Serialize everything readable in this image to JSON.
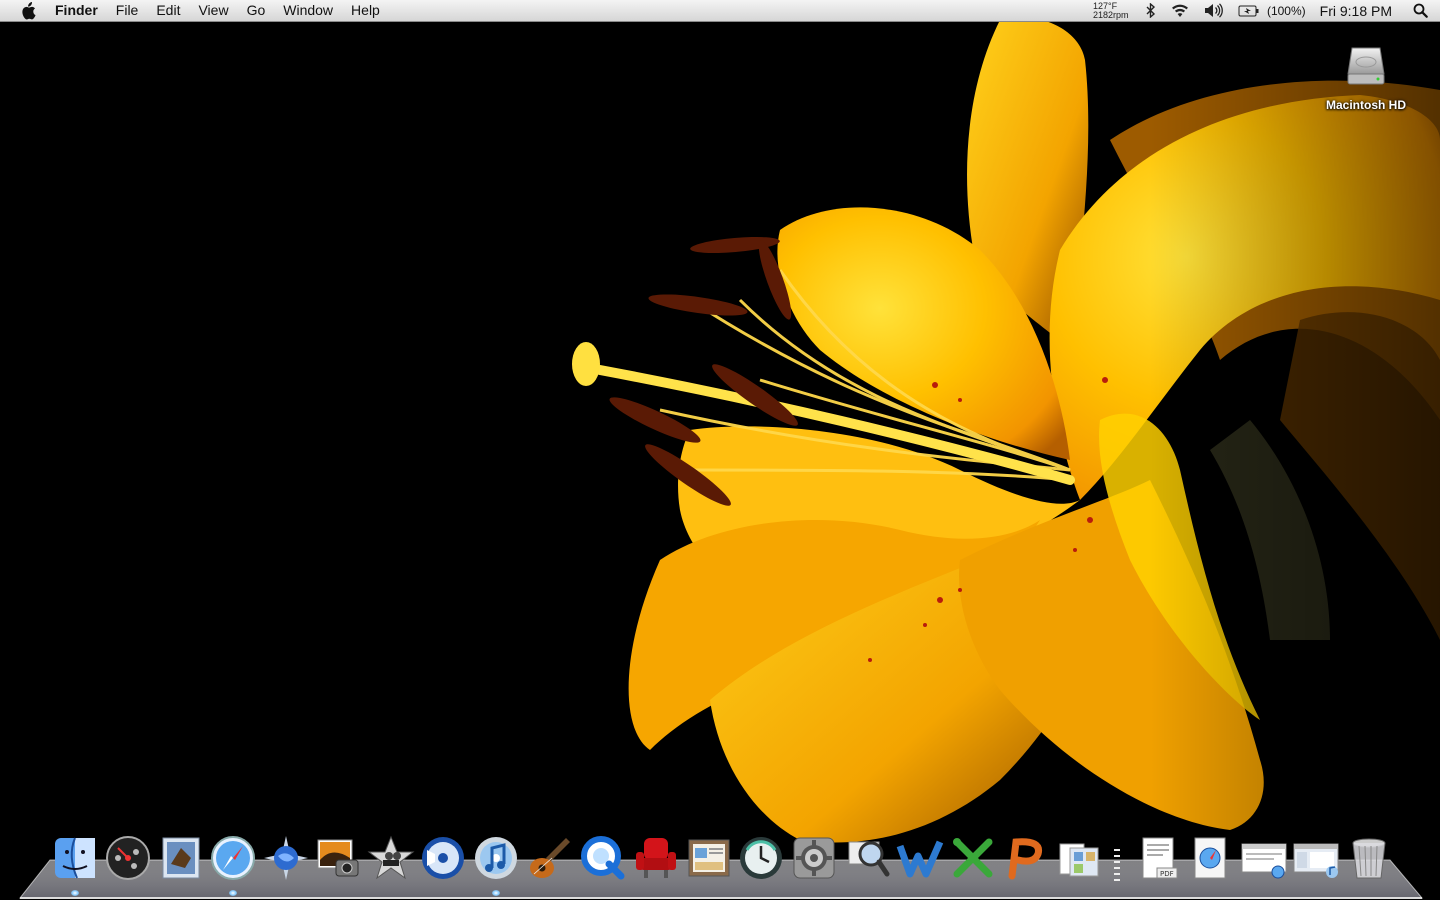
{
  "menubar": {
    "app_name": "Finder",
    "menus": [
      "File",
      "Edit",
      "View",
      "Go",
      "Window",
      "Help"
    ],
    "status": {
      "temperature": "127°F",
      "fan_speed": "2182rpm",
      "battery_percent": "(100%)",
      "clock": "Fri 9:18 PM"
    },
    "icons": [
      "apple-icon",
      "bluetooth-icon",
      "wifi-icon",
      "volume-icon",
      "battery-icon",
      "spotlight-icon"
    ]
  },
  "desktop": {
    "icons": [
      {
        "label": "Macintosh HD",
        "icon": "hard-drive-icon"
      }
    ]
  },
  "dock": {
    "apps": [
      {
        "name": "Finder",
        "icon": "finder-icon",
        "running": true
      },
      {
        "name": "Dashboard",
        "icon": "dashboard-icon",
        "running": false
      },
      {
        "name": "Mail",
        "icon": "mail-icon",
        "running": false
      },
      {
        "name": "Safari",
        "icon": "safari-icon",
        "running": true
      },
      {
        "name": "Camino",
        "icon": "camino-icon",
        "running": false
      },
      {
        "name": "iPhoto",
        "icon": "iphoto-icon",
        "running": false
      },
      {
        "name": "iMovie",
        "icon": "imovie-icon",
        "running": false
      },
      {
        "name": "iDVD",
        "icon": "idvd-icon",
        "running": false
      },
      {
        "name": "iTunes",
        "icon": "itunes-icon",
        "running": true
      },
      {
        "name": "GarageBand",
        "icon": "garageband-icon",
        "running": false
      },
      {
        "name": "QuickTime Player",
        "icon": "quicktime-icon",
        "running": false
      },
      {
        "name": "Front Row",
        "icon": "front-row-icon",
        "running": false
      },
      {
        "name": "iWeb",
        "icon": "iweb-icon",
        "running": false
      },
      {
        "name": "Time Machine",
        "icon": "time-machine-icon",
        "running": false
      },
      {
        "name": "System Preferences",
        "icon": "system-preferences-icon",
        "running": false
      },
      {
        "name": "Preview",
        "icon": "preview-icon",
        "running": false
      },
      {
        "name": "Word",
        "icon": "word-icon",
        "running": false
      },
      {
        "name": "Excel",
        "icon": "excel-icon",
        "running": false
      },
      {
        "name": "PowerPoint",
        "icon": "powerpoint-icon",
        "running": false
      },
      {
        "name": "Applications",
        "icon": "applications-stack-icon",
        "running": false
      }
    ],
    "documents": [
      {
        "name": "Documents",
        "icon": "documents-stack-icon"
      },
      {
        "name": "Downloads",
        "icon": "downloads-stack-icon"
      },
      {
        "name": "Web Page",
        "icon": "web-page-icon"
      },
      {
        "name": "Music Window",
        "icon": "itunes-window-icon"
      },
      {
        "name": "Trash",
        "icon": "trash-icon"
      }
    ]
  }
}
